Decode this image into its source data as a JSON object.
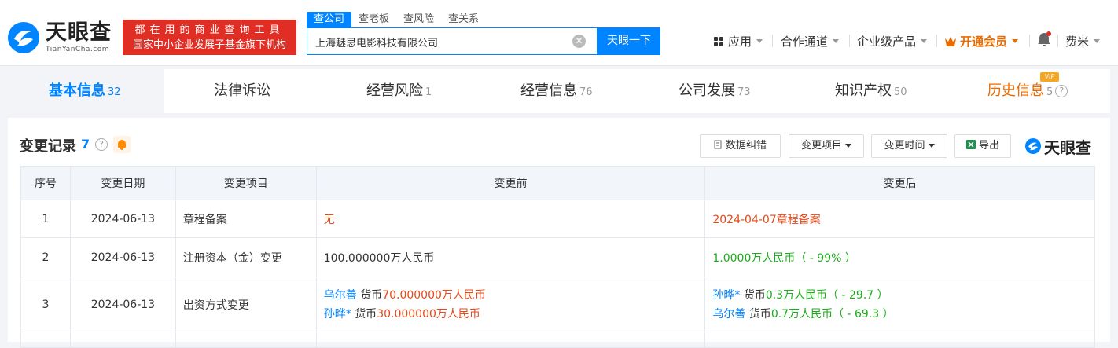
{
  "header": {
    "logo_cn": "天眼查",
    "logo_en": "TianYanCha.com",
    "slogan_line1": "都在用的商业查询工具",
    "slogan_line2": "国家中小企业发展子基金旗下机构",
    "search_tabs": [
      "查公司",
      "查老板",
      "查风险",
      "查关系"
    ],
    "search_value": "上海魅思电影科技有限公司",
    "search_button": "天眼一下",
    "nav": {
      "apps": "应用",
      "channel": "合作通道",
      "enterprise": "企业级产品",
      "vip": "开通会员",
      "user": "费米"
    }
  },
  "tabs": [
    {
      "label": "基本信息",
      "count": "32"
    },
    {
      "label": "法律诉讼",
      "count": ""
    },
    {
      "label": "经营风险",
      "count": "1"
    },
    {
      "label": "经营信息",
      "count": "76"
    },
    {
      "label": "公司发展",
      "count": "73"
    },
    {
      "label": "知识产权",
      "count": "50"
    },
    {
      "label": "历史信息",
      "count": "5"
    }
  ],
  "vip_tag": "VIP",
  "section": {
    "title": "变更记录",
    "count": "7",
    "buttons": {
      "correct": "数据纠错",
      "item": "变更项目",
      "time": "变更时间",
      "export": "导出"
    },
    "brand": "天眼查"
  },
  "table": {
    "headers": [
      "序号",
      "变更日期",
      "变更项目",
      "变更前",
      "变更后"
    ],
    "rows": [
      {
        "no": "1",
        "date": "2024-06-13",
        "item": "章程备案",
        "before": {
          "text": "无"
        },
        "after": {
          "text": "2024-04-07章程备案"
        }
      },
      {
        "no": "2",
        "date": "2024-06-13",
        "item": "注册资本（金）变更",
        "before": {
          "text": "100.000000万人民币"
        },
        "after": {
          "text": "1.0000万人民币（ - 99% ）"
        }
      },
      {
        "no": "3",
        "date": "2024-06-13",
        "item": "出资方式变更",
        "before": {
          "p1_name": "乌尔善",
          "p1_type": "货币",
          "p1_amount": "70.000000万人民币",
          "p2_name": "孙晔*",
          "p2_type": "货币",
          "p2_amount": "30.000000万人民币"
        },
        "after": {
          "p1_name": "孙晔*",
          "p1_type": "货币",
          "p1_amount": "0.3万人民币（ - 29.7 ）",
          "p2_name": "乌尔善",
          "p2_type": "货币",
          "p2_amount": "0.7万人民币（ - 69.3 ）"
        }
      }
    ]
  }
}
